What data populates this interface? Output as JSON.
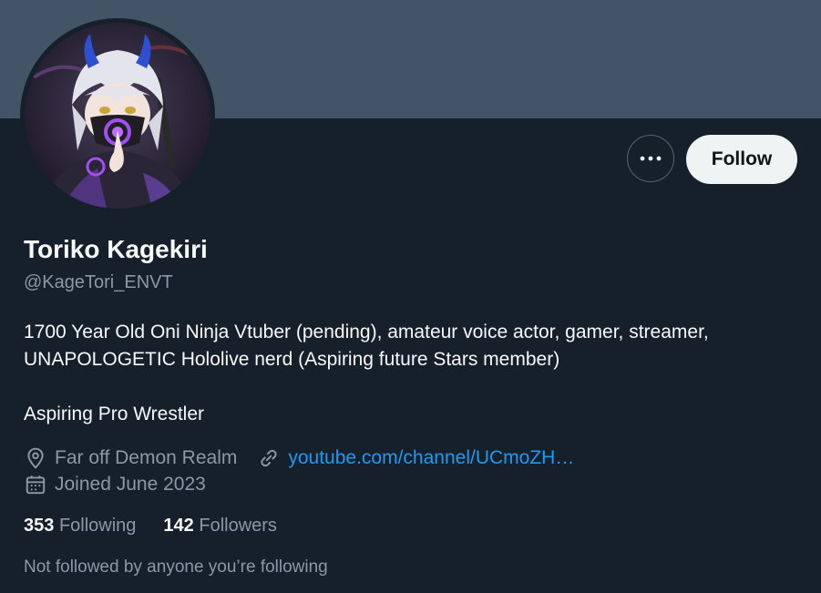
{
  "profile": {
    "display_name": "Toriko Kagekiri",
    "handle": "@KageTori_ENVT",
    "bio_lines": [
      "1700 Year Old Oni Ninja Vtuber (pending), amateur voice actor, gamer, streamer,",
      "UNAPOLOGETIC Hololive nerd (Aspiring future Stars member)",
      "Aspiring Pro Wrestler"
    ],
    "location": "Far off Demon Realm",
    "website": "youtube.com/channel/UCmoZH…",
    "joined": "Joined June 2023",
    "not_followed_text": "Not followed by anyone you’re following"
  },
  "stats": {
    "following_count": "353",
    "following_label": "Following",
    "followers_count": "142",
    "followers_label": "Followers"
  },
  "actions": {
    "follow_label": "Follow",
    "more_icon": "more-horizontal-icon"
  },
  "icons": {
    "location": "location-pin-icon",
    "link": "link-icon",
    "calendar": "calendar-icon"
  },
  "colors": {
    "background": "#15202b",
    "banner": "#425466",
    "link": "#1d9bf0",
    "secondary_text": "#8b98a5",
    "follow_button_bg": "#eff3f4"
  }
}
